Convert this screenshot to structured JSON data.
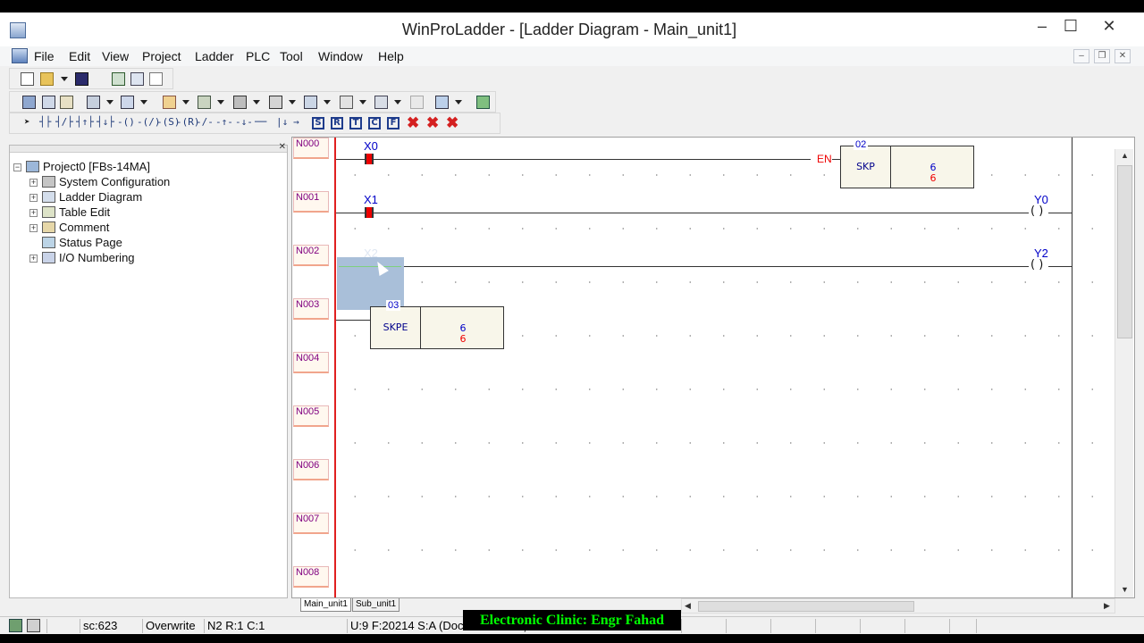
{
  "window": {
    "title": "WinProLadder - [Ladder Diagram - Main_unit1]",
    "minimize": "–",
    "maximize": "☐",
    "close": "✕"
  },
  "menu": {
    "items": [
      "File",
      "Edit",
      "View",
      "Project",
      "Ladder",
      "PLC",
      "Tool",
      "Window",
      "Help"
    ],
    "mdi_minimize": "–",
    "mdi_restore": "❐",
    "mdi_close": "✕"
  },
  "toolbar3": {
    "box_buttons": [
      "S",
      "R",
      "T",
      "C",
      "F"
    ]
  },
  "tree": {
    "close": "✕",
    "root": "Project0 [FBs-14MA]",
    "items": [
      "System Configuration",
      "Ladder Diagram",
      "Table Edit",
      "Comment",
      "Status Page",
      "I/O Numbering"
    ]
  },
  "ladder": {
    "row_labels": [
      "N000",
      "N001",
      "N002",
      "N003",
      "N004",
      "N005",
      "N006",
      "N007",
      "N008"
    ],
    "rung0": {
      "contact": "X0",
      "en_label": "EN",
      "fn_number": "02",
      "fn_name": "SKP",
      "fn_value_blue": "6",
      "fn_value_red": "6"
    },
    "rung1": {
      "contact": "X1",
      "coil": "Y0"
    },
    "rung2": {
      "contact": "X2",
      "coil": "Y2"
    },
    "rung3": {
      "fn_number": "03",
      "fn_name": "SKPE",
      "fn_value_blue": "6",
      "fn_value_red": "6"
    },
    "coil_glyph": "( )"
  },
  "sheets": [
    "Main_unit1",
    "Sub_unit1"
  ],
  "status": {
    "scan": "sc:623",
    "mode": "Overwrite",
    "position": "N2 R:1 C:1",
    "info": "U:9 F:20214 S:A (Doc U:0 F:2101)"
  },
  "watermark": "Electronic Clinic:  Engr Fahad"
}
